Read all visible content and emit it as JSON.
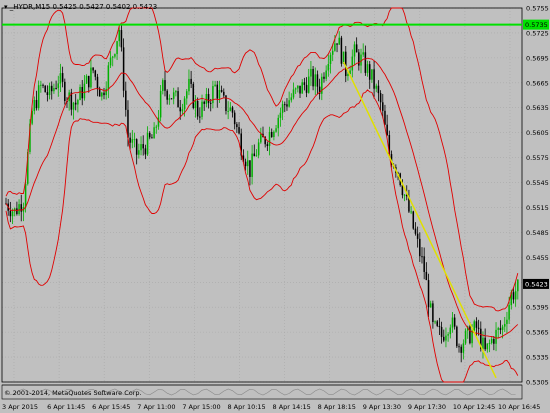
{
  "window": {
    "symbol": "_HYDR,M15",
    "ohlc": [
      "0.5425",
      "0.5427",
      "0.5402",
      "0.5423"
    ],
    "copyright": "© 2001-2014, MetaQuotes Software Corp."
  },
  "colors": {
    "background": "#c0c0c0",
    "grid": "#a8a8a8",
    "bullish_candle": "#00b000",
    "bearish_candle": "#000000",
    "bollinger_bands": "#e00000",
    "horizontal_line": "#00e000",
    "trend_line": "#e0e000",
    "current_price_label_bg": "#000000"
  },
  "chart_data": {
    "type": "candlestick",
    "timeframe": "M15",
    "y_axis": {
      "min": 0.5305,
      "max": 0.5755,
      "tick_labels": [
        "0.5755",
        "0.5725",
        "0.5695",
        "0.5665",
        "0.5635",
        "0.5605",
        "0.5575",
        "0.5545",
        "0.5515",
        "0.5485",
        "0.5455",
        "0.5425",
        "0.5395",
        "0.5365",
        "0.5335",
        "0.5305"
      ]
    },
    "x_axis": {
      "tick_labels": [
        "3 Apr 2015",
        "6 Apr 11:45",
        "6 Apr 15:45",
        "7 Apr 11:00",
        "7 Apr 15:00",
        "8 Apr 10:15",
        "8 Apr 14:15",
        "8 Apr 18:15",
        "9 Apr 13:30",
        "9 Apr 17:30",
        "10 Apr 12:45",
        "10 Apr 16:45"
      ]
    },
    "horizontal_line_level": 0.5735,
    "horizontal_line_label": "0.5735",
    "current_price": 0.5423,
    "current_price_label": "0.5423",
    "trend_line": {
      "from_price": 0.569,
      "to_price": 0.531
    },
    "price_path": [
      0.552,
      0.551,
      0.5525,
      0.563,
      0.566,
      0.565,
      0.567,
      0.565,
      0.564,
      0.566,
      0.568,
      0.565,
      0.569,
      0.573,
      0.56,
      0.558,
      0.559,
      0.56,
      0.566,
      0.565,
      0.564,
      0.566,
      0.563,
      0.564,
      0.566,
      0.564,
      0.563,
      0.559,
      0.556,
      0.559,
      0.56,
      0.562,
      0.564,
      0.565,
      0.566,
      0.567,
      0.566,
      0.57,
      0.572,
      0.568,
      0.57,
      0.569,
      0.567,
      0.564,
      0.558,
      0.556,
      0.552,
      0.548,
      0.544,
      0.537,
      0.536,
      0.538,
      0.535,
      0.536,
      0.537,
      0.534,
      0.536,
      0.537,
      0.541,
      0.542
    ]
  }
}
